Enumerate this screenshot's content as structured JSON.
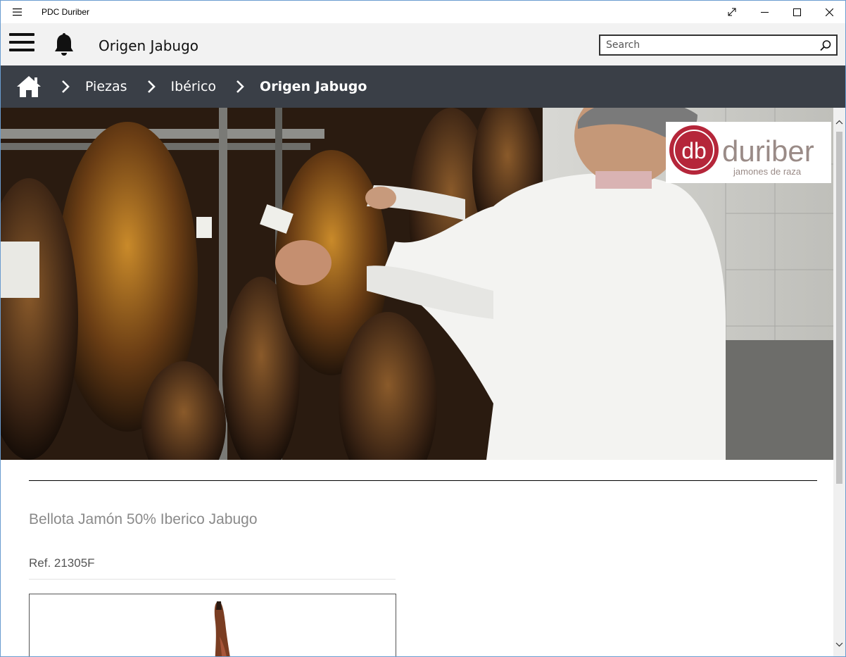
{
  "window": {
    "title": "PDC Duriber"
  },
  "header": {
    "page_title": "Origen Jabugo",
    "search_placeholder": "Search"
  },
  "breadcrumb": {
    "items": [
      "Piezas",
      "Ibérico"
    ],
    "current": "Origen Jabugo"
  },
  "hero": {
    "logo_text": "duriber",
    "logo_tagline": "jamones de raza",
    "logo_mark": "db"
  },
  "product": {
    "name": "Bellota Jamón 50% Iberico Jabugo",
    "ref": "Ref. 21305F"
  },
  "icons": {
    "menu": "hamburger-icon",
    "notifications": "bell-icon",
    "search": "search-icon",
    "home": "home-icon"
  },
  "colors": {
    "breadcrumb_bg": "#3a3f47",
    "appbar_bg": "#f2f2f2",
    "brand_red": "#b5263a",
    "product_name": "#8a8a8a"
  }
}
